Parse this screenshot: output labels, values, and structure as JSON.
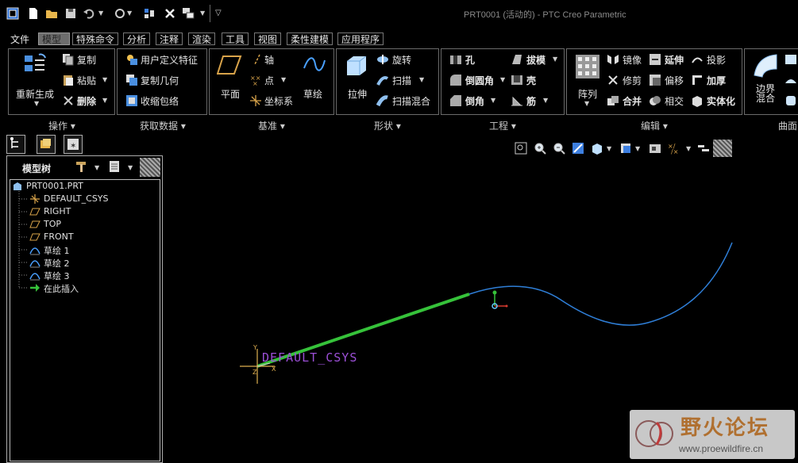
{
  "window": {
    "title": "PRT0001 (活动的) - PTC Creo Parametric"
  },
  "menu": {
    "file": "文件",
    "tabs": [
      "模型",
      "特殊命令",
      "分析",
      "注释",
      "渲染",
      "工具",
      "视图",
      "柔性建模",
      "应用程序"
    ]
  },
  "ribbon": {
    "operations": {
      "label": "操作",
      "regenerate": "重新生成",
      "copy": "复制",
      "paste": "粘贴",
      "delete": "删除"
    },
    "get_data": {
      "label": "获取数据",
      "udf": "用户定义特征",
      "copy_geom": "复制几何",
      "shrinkwrap": "收缩包络"
    },
    "datum": {
      "label": "基准",
      "plane": "平面",
      "axis": "轴",
      "point": "点",
      "csys": "坐标系",
      "sketch": "草绘"
    },
    "shapes": {
      "label": "形状",
      "extrude": "拉伸",
      "revolve": "旋转",
      "sweep": "扫描",
      "swept_blend": "扫描混合"
    },
    "engineering": {
      "label": "工程",
      "hole": "孔",
      "draft": "拔模",
      "round": "倒圆角",
      "shell": "壳",
      "chamfer": "倒角",
      "rib": "筋"
    },
    "editing": {
      "label": "编辑",
      "pattern": "阵列",
      "mirror": "镜像",
      "extend": "延伸",
      "project": "投影",
      "trim": "修剪",
      "offset": "偏移",
      "thicken": "加厚",
      "merge": "合并",
      "intersect": "相交",
      "solidify": "实体化"
    },
    "surfaces": {
      "label": "曲面",
      "boundary_blend": "边界\n混合"
    }
  },
  "model_tree": {
    "title": "模型树",
    "items": [
      {
        "label": "PRT0001.PRT",
        "icon": "part-icon"
      },
      {
        "label": "DEFAULT_CSYS",
        "icon": "csys-icon"
      },
      {
        "label": "RIGHT",
        "icon": "datum-plane-icon"
      },
      {
        "label": "TOP",
        "icon": "datum-plane-icon"
      },
      {
        "label": "FRONT",
        "icon": "datum-plane-icon"
      },
      {
        "label": "草绘 1",
        "icon": "sketch-icon"
      },
      {
        "label": "草绘 2",
        "icon": "sketch-icon"
      },
      {
        "label": "草绘 3",
        "icon": "sketch-icon"
      },
      {
        "label": "在此插入",
        "icon": "insert-here-icon"
      }
    ]
  },
  "graphics": {
    "csys_label": "DEFAULT_CSYS"
  },
  "watermark": {
    "title": "野火论坛",
    "url": "www.proewildfire.cn"
  },
  "colors": {
    "background": "#000000",
    "curve_blue": "#2f7fd8",
    "curve_green": "#36c23a",
    "csys_purple": "#9b4fd6"
  }
}
